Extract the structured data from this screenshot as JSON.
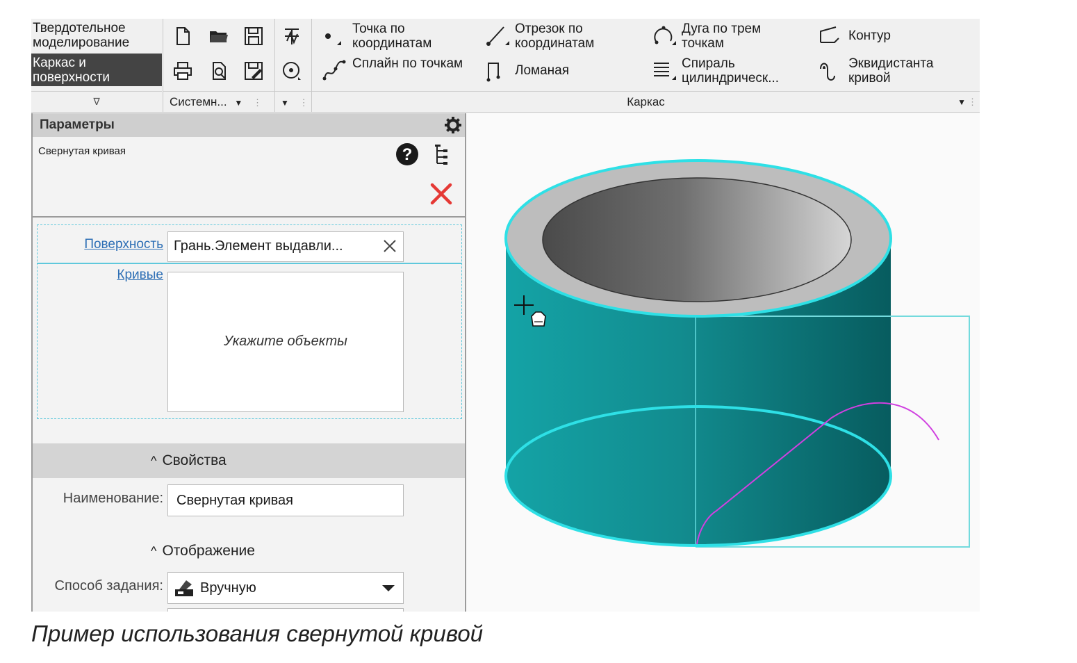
{
  "ribbon": {
    "modes": [
      "Твердотельное моделирование",
      "Каркас и поверхности"
    ],
    "system_group_label": "Системн...",
    "carcass_group_label": "Каркас",
    "commands": {
      "point": "Точка по координатам",
      "segment": "Отрезок по координатам",
      "arc": "Дуга по трем точкам",
      "contour": "Контур",
      "spline": "Сплайн по точкам",
      "polyline": "Ломаная",
      "spiral": "Спираль цилиндрическ...",
      "offset": "Эквидистанта кривой"
    }
  },
  "panel": {
    "title": "Параметры",
    "object_name": "Свернутая кривая",
    "surface_label": "Поверхность",
    "surface_value": "Грань.Элемент выдавли...",
    "curves_label": "Кривые",
    "curves_placeholder": "Укажите объекты",
    "properties_title": "Свойства",
    "name_label": "Наименование:",
    "name_value": "Свернутая кривая",
    "display_title": "Отображение",
    "method_label": "Способ задания:",
    "method_value": "Вручную"
  },
  "colors": {
    "accent_cyan": "#2ee0e6",
    "curve_magenta": "#d040e0",
    "cylinder_teal": "#138f92",
    "close_red": "#e53935"
  },
  "caption": "Пример использования свернутой кривой"
}
